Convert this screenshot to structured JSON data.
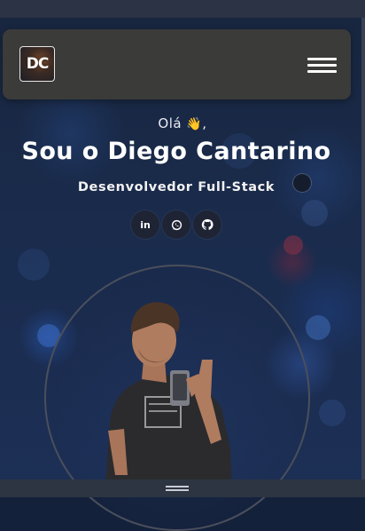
{
  "header": {
    "logo_text": "DC",
    "menu_icon": "hamburger-icon"
  },
  "hero": {
    "greeting": "Olá",
    "greeting_emoji": "👋",
    "greeting_suffix": ",",
    "name": "Sou o Diego Cantarino",
    "role": "Desenvolvedor Full-Stack"
  },
  "social_links": [
    {
      "icon": "linkedin-icon",
      "glyph": "in"
    },
    {
      "icon": "whatsapp-icon"
    },
    {
      "icon": "github-icon"
    }
  ],
  "colors": {
    "background": "#14213a",
    "navbar": "#3b3b3a",
    "text": "#ffffff",
    "social_button": "#1e2433",
    "photo_ring": "#4a4f5c"
  }
}
